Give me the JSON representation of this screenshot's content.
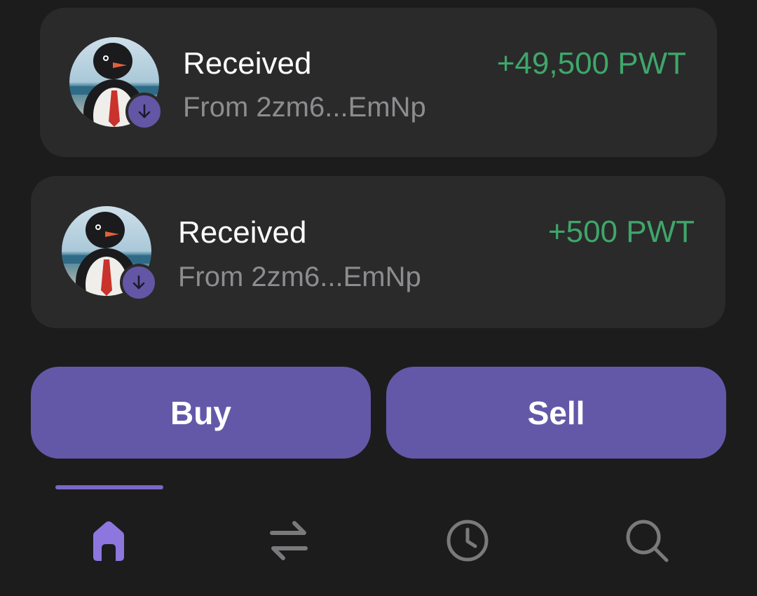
{
  "transactions": [
    {
      "type_label": "Received",
      "counterparty": "From 2zm6...EmNp",
      "amount": "+49,500 PWT",
      "avatar_icon": "penguin-avatar-icon",
      "badge_icon": "arrow-down-icon"
    },
    {
      "type_label": "Received",
      "counterparty": "From 2zm6...EmNp",
      "amount": "+500 PWT",
      "avatar_icon": "penguin-avatar-icon",
      "badge_icon": "arrow-down-icon"
    }
  ],
  "actions": {
    "buy_label": "Buy",
    "sell_label": "Sell"
  },
  "bottom_nav": {
    "items": [
      {
        "icon": "home-icon",
        "active": true
      },
      {
        "icon": "swap-icon",
        "active": false
      },
      {
        "icon": "clock-icon",
        "active": false
      },
      {
        "icon": "search-icon",
        "active": false
      }
    ]
  },
  "colors": {
    "background": "#1c1c1d",
    "card": "#2a2a2b",
    "accent": "#6358a8",
    "active_nav": "#7a68c6",
    "positive_amount": "#3ea769",
    "secondary_text": "#8d8d90"
  }
}
